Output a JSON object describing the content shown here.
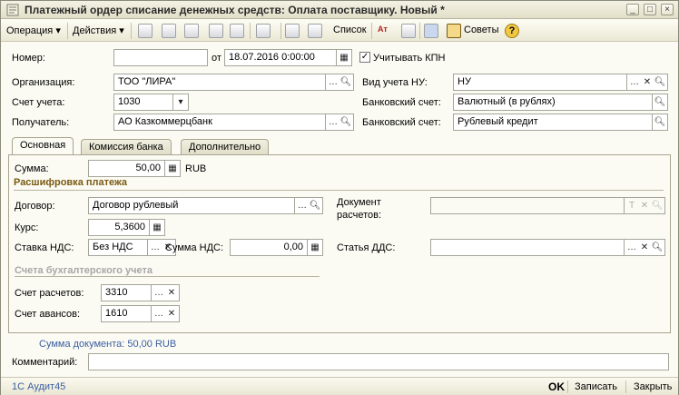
{
  "window": {
    "title": "Платежный ордер списание денежных средств: Оплата поставщику. Новый *"
  },
  "toolbar": {
    "operation_label": "Операция",
    "actions_label": "Действия",
    "list_label": "Список",
    "tips_label": "Советы"
  },
  "header": {
    "number_label": "Номер:",
    "number_value": "",
    "date_prefix": "от",
    "date_value": "18.07.2016  0:00:00",
    "kpn_label": "Учитывать КПН",
    "kpn_checked": true,
    "org_label": "Организация:",
    "org_value": "ТОО \"ЛИРА\"",
    "nu_label": "Вид учета НУ:",
    "nu_value": "НУ",
    "account_label": "Счет учета:",
    "account_value": "1030",
    "bank1_label": "Банковский счет:",
    "bank1_value": "Валютный (в рублях)",
    "recipient_label": "Получатель:",
    "recipient_value": "АО Казкоммерцбанк",
    "bank2_label": "Банковский счет:",
    "bank2_value": "Рублевый кредит"
  },
  "tabs": [
    {
      "label": "Основная",
      "active": true
    },
    {
      "label": "Комиссия банка",
      "active": false
    },
    {
      "label": "Дополнительно",
      "active": false
    }
  ],
  "main": {
    "sum_label": "Сумма:",
    "sum_value": "50,00",
    "currency": "RUB",
    "decode_section": "Расшифровка платежа",
    "contract_label": "Договор:",
    "contract_value": "Договор рублевый",
    "doc_label_1": "Документ",
    "doc_label_2": "расчетов:",
    "doc_value": "",
    "rate_label": "Курс:",
    "rate_value": "5,3600",
    "vat_rate_label": "Ставка НДС:",
    "vat_rate_value": "Без НДС",
    "vat_sum_label": "Сумма НДС:",
    "vat_sum_value": "0,00",
    "dds_label": "Статья ДДС:",
    "dds_value": "",
    "accounts_section": "Счета бухгалтерского учета",
    "settle_label": "Счет расчетов:",
    "settle_value": "3310",
    "advance_label": "Счет авансов:",
    "advance_value": "1610"
  },
  "footer": {
    "doc_sum_text": "Сумма документа: 50,00 RUB",
    "comment_label": "Комментарий:",
    "comment_value": "",
    "status_text": "1С Аудит45",
    "ok_label": "OK",
    "save_label": "Записать",
    "close_label": "Закрыть"
  },
  "colors": {
    "section_title": "#7a5a10",
    "link": "#3c5fa0",
    "background": "#fbfbf4"
  }
}
